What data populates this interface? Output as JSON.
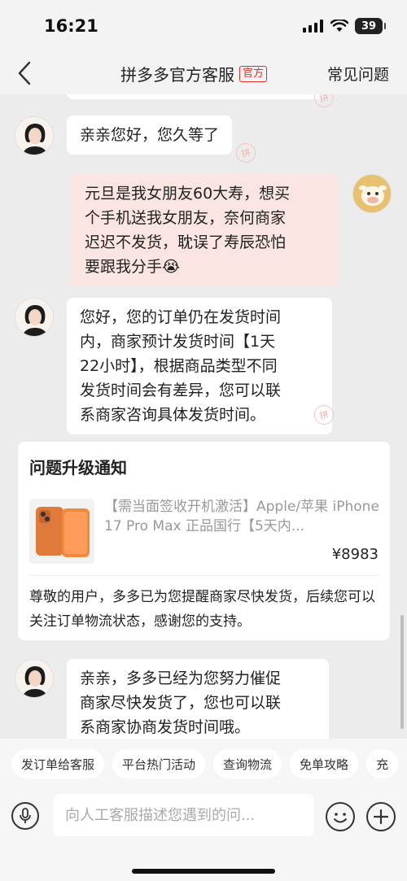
{
  "status_bar": {
    "time": "16:21",
    "battery": "39"
  },
  "header": {
    "title": "拼多多官方客服",
    "badge": "官方",
    "faq_label": "常见问题"
  },
  "messages": [
    {
      "side": "agent",
      "text": "亲亲您好，您久等了"
    },
    {
      "side": "user",
      "text": "元旦是我女朋友60大寿，想买\n个手机送我女朋友，奈何商家\n迟迟不发货，耽误了寿辰恐怕\n要跟我分手😭"
    },
    {
      "side": "agent",
      "text": "您好，您的订单仍在发货时间\n内，商家预计发货时间【1天\n22小时】，根据商品类型不同\n发货时间会有差异，您可以联\n系商家咨询具体发货时间。"
    },
    {
      "side": "agent",
      "text": "亲亲，多多已经为您努力催促\n商家尽快发货了，您也可以联\n系商家协商发货时间哦。"
    }
  ],
  "notice_card": {
    "title": "问题升级通知",
    "product_name": "【需当面签收开机激活】Apple/苹果 iPhone 17 Pro Max 正品国行【5天内...",
    "price": "¥8983",
    "body": "尊敬的用户，多多已为您提醒商家尽快发货，后续您可以关注订单物流状态，感谢您的支持。"
  },
  "stamp_char": "拼",
  "quick_actions": [
    "发订单给客服",
    "平台热门活动",
    "查询物流",
    "免单攻略",
    "充"
  ],
  "input": {
    "placeholder": "向人工客服描述您遇到的问..."
  },
  "colors": {
    "accent": "#e02e24",
    "user_bubble": "#fbe5e3",
    "chat_bg": "#ececec"
  }
}
